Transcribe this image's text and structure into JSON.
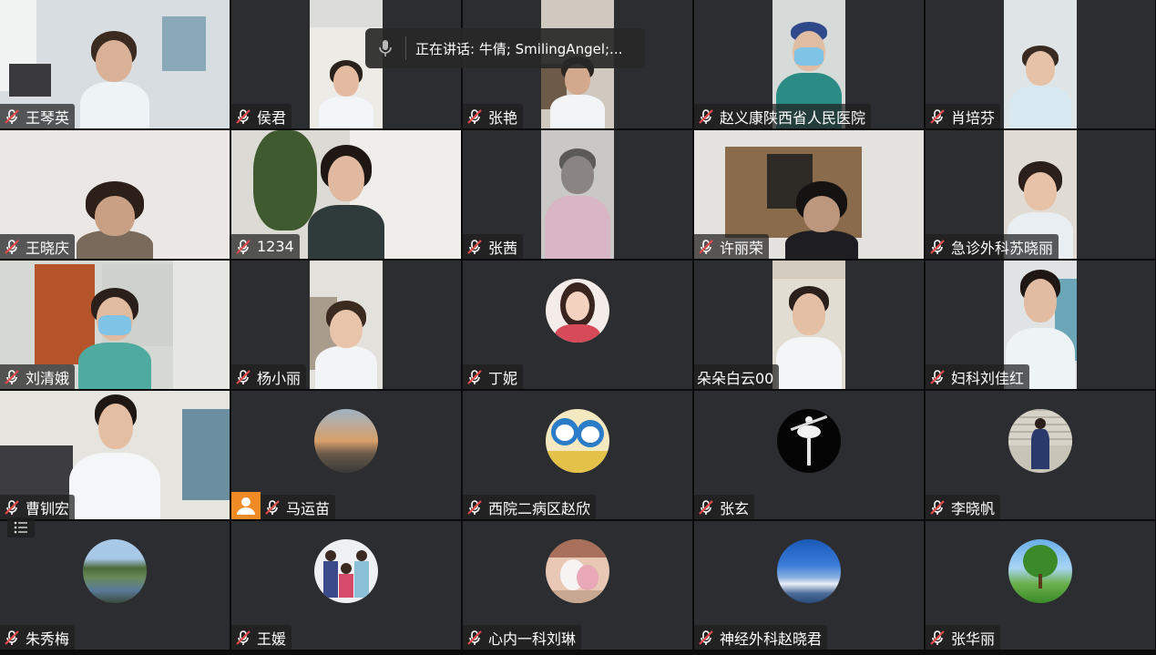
{
  "speaker_banner": {
    "label": "正在讲话: 牛倩; SmilingAngel;..."
  },
  "participants": [
    {
      "name": "王琴英",
      "muted": true
    },
    {
      "name": "侯君",
      "muted": true
    },
    {
      "name": "张艳",
      "muted": true
    },
    {
      "name": "赵义康陕西省人民医院",
      "muted": true
    },
    {
      "name": "肖培芬",
      "muted": true
    },
    {
      "name": "王晓庆",
      "muted": true
    },
    {
      "name": "1234",
      "muted": true
    },
    {
      "name": "张茜",
      "muted": true
    },
    {
      "name": "许丽荣",
      "muted": true
    },
    {
      "name": "急诊外科苏晓丽",
      "muted": true
    },
    {
      "name": "刘清娥",
      "muted": true
    },
    {
      "name": "杨小丽",
      "muted": true
    },
    {
      "name": "丁妮",
      "muted": true
    },
    {
      "name": "朵朵白云00",
      "muted": false
    },
    {
      "name": "妇科刘佳红",
      "muted": true
    },
    {
      "name": "曹钏宏",
      "muted": true
    },
    {
      "name": "马运苗",
      "muted": true,
      "host": true
    },
    {
      "name": "西院二病区赵欣",
      "muted": true
    },
    {
      "name": "张玄",
      "muted": true
    },
    {
      "name": "李晓帆",
      "muted": true
    },
    {
      "name": "朱秀梅",
      "muted": true
    },
    {
      "name": "王媛",
      "muted": true
    },
    {
      "name": "心内一科刘琳",
      "muted": true
    },
    {
      "name": "神经外科赵晓君",
      "muted": true
    },
    {
      "name": "张华丽",
      "muted": true
    }
  ],
  "colors": {
    "tile_bg": "#2c2d30",
    "muted_icon": "#e24a4a",
    "host_badge": "#f08a24"
  },
  "icons": {
    "muted": "mic-muted-icon",
    "speaking": "microphone-icon",
    "host": "host-person-icon",
    "list": "participant-list-icon"
  }
}
